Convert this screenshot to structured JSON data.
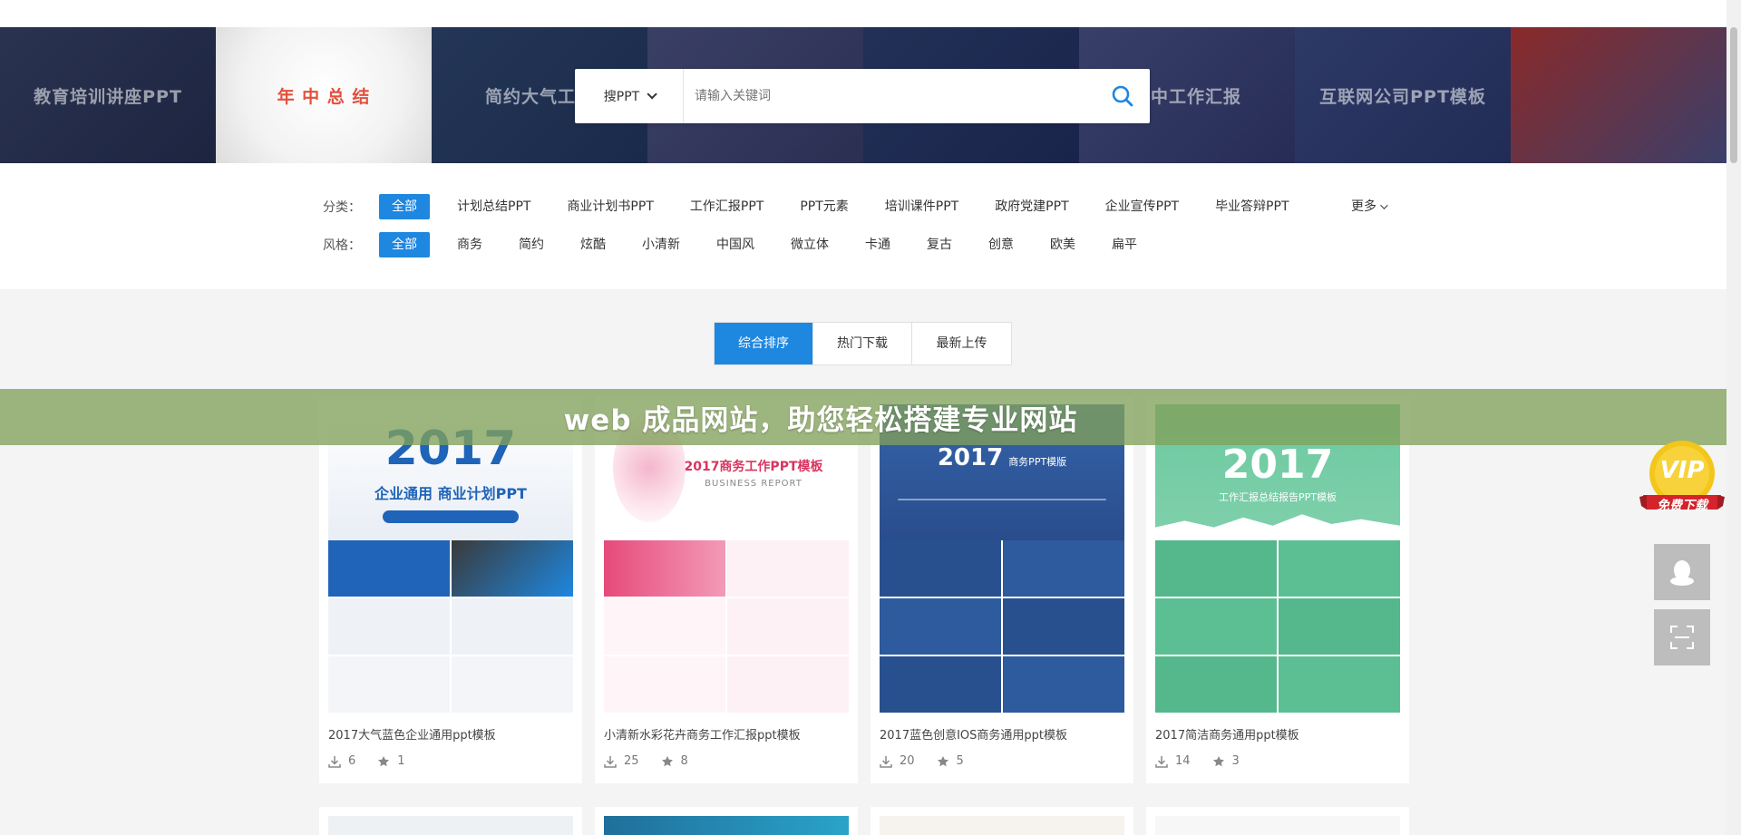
{
  "banner": {
    "tiles": [
      {
        "title": "教育培训讲座PPT",
        "sub": ""
      },
      {
        "title": "年 中 总 结",
        "sub": ""
      },
      {
        "title": "简约大气工作",
        "sub": ""
      },
      {
        "title": "",
        "sub": ""
      },
      {
        "title": "",
        "sub": ""
      },
      {
        "title": "年中工作汇报",
        "sub": ""
      },
      {
        "title": "互联网公司PPT模板",
        "sub": ""
      },
      {
        "title": "",
        "sub": ""
      }
    ]
  },
  "search": {
    "type_label": "搜PPT",
    "placeholder": "请输入关键词"
  },
  "filters": {
    "category_label": "分类：",
    "categories": [
      "全部",
      "计划总结PPT",
      "商业计划书PPT",
      "工作汇报PPT",
      "PPT元素",
      "培训课件PPT",
      "政府党建PPT",
      "企业宣传PPT",
      "毕业答辩PPT"
    ],
    "more_label": "更多",
    "style_label": "风格：",
    "styles": [
      "全部",
      "商务",
      "简约",
      "炫酷",
      "小清新",
      "中国风",
      "微立体",
      "卡通",
      "复古",
      "创意",
      "欧美",
      "扁平"
    ]
  },
  "sort": {
    "tabs": [
      "综合排序",
      "热门下载",
      "最新上传"
    ]
  },
  "cards": [
    {
      "title": "2017大气蓝色企业通用ppt模板",
      "downloads": "6",
      "favorites": "1",
      "thumb_year": "2017",
      "thumb_caption": "企业通用 商业计划PPT"
    },
    {
      "title": "小清新水彩花卉商务工作汇报ppt模板",
      "downloads": "25",
      "favorites": "8",
      "thumb_year": "2017商务工作PPT模板",
      "thumb_caption": "BUSINESS REPORT"
    },
    {
      "title": "2017蓝色创意IOS商务通用ppt模板",
      "downloads": "20",
      "favorites": "5",
      "thumb_year": "2017",
      "thumb_caption": "商务PPT模版"
    },
    {
      "title": "2017简洁商务通用ppt模板",
      "downloads": "14",
      "favorites": "3",
      "thumb_year": "2017",
      "thumb_caption": "工作汇报总结报告PPT模板"
    }
  ],
  "overlay": {
    "text": "web 成品网站，助您轻松搭建专业网站"
  },
  "side": {
    "vip_label": "VIP",
    "vip_sub": "免费下载"
  },
  "colors": {
    "accent": "#1e87e0",
    "overlay": "#82a05a"
  }
}
